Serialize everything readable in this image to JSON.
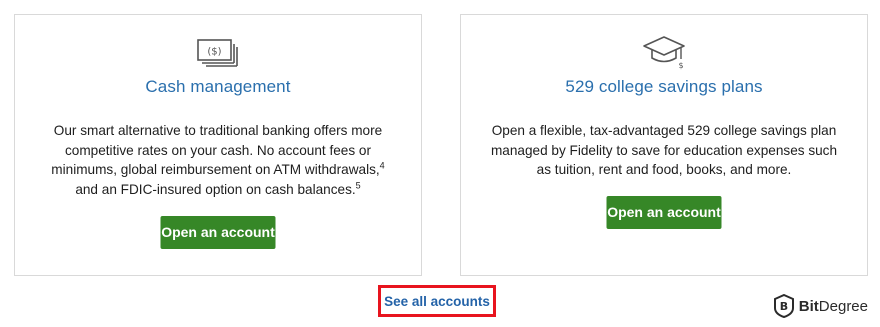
{
  "cards": [
    {
      "icon": "cash-icon",
      "title": "Cash management",
      "description_lines": [
        "Our smart alternative to traditional banking offers more",
        "competitive rates on your cash. No account fees or",
        "minimums, global reimbursement on ATM withdrawals,",
        "and an FDIC-insured option on cash balances."
      ],
      "footnotes": [
        "4",
        "5"
      ],
      "button_label": "Open an account"
    },
    {
      "icon": "graduation-cap-icon",
      "title": "529 college savings plans",
      "description_lines": [
        "Open a flexible, tax-advantaged 529 college savings plan",
        "managed by Fidelity to save for education expenses such",
        "as tuition, rent and food, books, and more."
      ],
      "button_label": "Open an account"
    }
  ],
  "see_all_label": "See all accounts",
  "highlight_color": "#e8141e",
  "accent_green": "#368727",
  "title_blue": "#2a6fad",
  "watermark": {
    "icon": "bitdegree-logo-icon",
    "text_bold": "Bit",
    "text_light": "Degree"
  }
}
